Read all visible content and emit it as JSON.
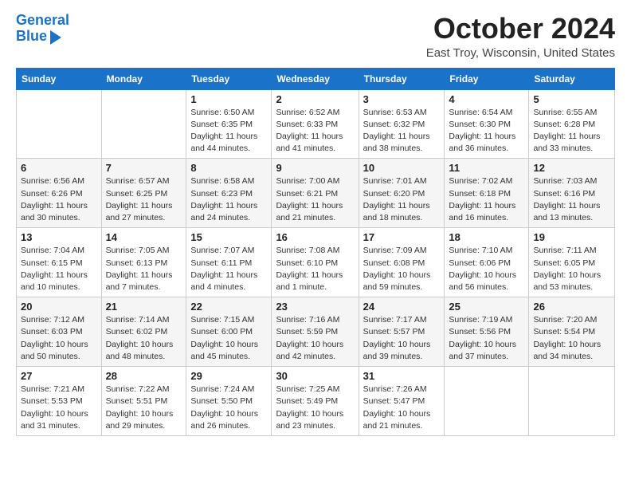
{
  "header": {
    "logo_line1": "General",
    "logo_line2": "Blue",
    "month_title": "October 2024",
    "location": "East Troy, Wisconsin, United States"
  },
  "weekdays": [
    "Sunday",
    "Monday",
    "Tuesday",
    "Wednesday",
    "Thursday",
    "Friday",
    "Saturday"
  ],
  "weeks": [
    [
      {
        "day": "",
        "sunrise": "",
        "sunset": "",
        "daylight": ""
      },
      {
        "day": "",
        "sunrise": "",
        "sunset": "",
        "daylight": ""
      },
      {
        "day": "1",
        "sunrise": "Sunrise: 6:50 AM",
        "sunset": "Sunset: 6:35 PM",
        "daylight": "Daylight: 11 hours and 44 minutes."
      },
      {
        "day": "2",
        "sunrise": "Sunrise: 6:52 AM",
        "sunset": "Sunset: 6:33 PM",
        "daylight": "Daylight: 11 hours and 41 minutes."
      },
      {
        "day": "3",
        "sunrise": "Sunrise: 6:53 AM",
        "sunset": "Sunset: 6:32 PM",
        "daylight": "Daylight: 11 hours and 38 minutes."
      },
      {
        "day": "4",
        "sunrise": "Sunrise: 6:54 AM",
        "sunset": "Sunset: 6:30 PM",
        "daylight": "Daylight: 11 hours and 36 minutes."
      },
      {
        "day": "5",
        "sunrise": "Sunrise: 6:55 AM",
        "sunset": "Sunset: 6:28 PM",
        "daylight": "Daylight: 11 hours and 33 minutes."
      }
    ],
    [
      {
        "day": "6",
        "sunrise": "Sunrise: 6:56 AM",
        "sunset": "Sunset: 6:26 PM",
        "daylight": "Daylight: 11 hours and 30 minutes."
      },
      {
        "day": "7",
        "sunrise": "Sunrise: 6:57 AM",
        "sunset": "Sunset: 6:25 PM",
        "daylight": "Daylight: 11 hours and 27 minutes."
      },
      {
        "day": "8",
        "sunrise": "Sunrise: 6:58 AM",
        "sunset": "Sunset: 6:23 PM",
        "daylight": "Daylight: 11 hours and 24 minutes."
      },
      {
        "day": "9",
        "sunrise": "Sunrise: 7:00 AM",
        "sunset": "Sunset: 6:21 PM",
        "daylight": "Daylight: 11 hours and 21 minutes."
      },
      {
        "day": "10",
        "sunrise": "Sunrise: 7:01 AM",
        "sunset": "Sunset: 6:20 PM",
        "daylight": "Daylight: 11 hours and 18 minutes."
      },
      {
        "day": "11",
        "sunrise": "Sunrise: 7:02 AM",
        "sunset": "Sunset: 6:18 PM",
        "daylight": "Daylight: 11 hours and 16 minutes."
      },
      {
        "day": "12",
        "sunrise": "Sunrise: 7:03 AM",
        "sunset": "Sunset: 6:16 PM",
        "daylight": "Daylight: 11 hours and 13 minutes."
      }
    ],
    [
      {
        "day": "13",
        "sunrise": "Sunrise: 7:04 AM",
        "sunset": "Sunset: 6:15 PM",
        "daylight": "Daylight: 11 hours and 10 minutes."
      },
      {
        "day": "14",
        "sunrise": "Sunrise: 7:05 AM",
        "sunset": "Sunset: 6:13 PM",
        "daylight": "Daylight: 11 hours and 7 minutes."
      },
      {
        "day": "15",
        "sunrise": "Sunrise: 7:07 AM",
        "sunset": "Sunset: 6:11 PM",
        "daylight": "Daylight: 11 hours and 4 minutes."
      },
      {
        "day": "16",
        "sunrise": "Sunrise: 7:08 AM",
        "sunset": "Sunset: 6:10 PM",
        "daylight": "Daylight: 11 hours and 1 minute."
      },
      {
        "day": "17",
        "sunrise": "Sunrise: 7:09 AM",
        "sunset": "Sunset: 6:08 PM",
        "daylight": "Daylight: 10 hours and 59 minutes."
      },
      {
        "day": "18",
        "sunrise": "Sunrise: 7:10 AM",
        "sunset": "Sunset: 6:06 PM",
        "daylight": "Daylight: 10 hours and 56 minutes."
      },
      {
        "day": "19",
        "sunrise": "Sunrise: 7:11 AM",
        "sunset": "Sunset: 6:05 PM",
        "daylight": "Daylight: 10 hours and 53 minutes."
      }
    ],
    [
      {
        "day": "20",
        "sunrise": "Sunrise: 7:12 AM",
        "sunset": "Sunset: 6:03 PM",
        "daylight": "Daylight: 10 hours and 50 minutes."
      },
      {
        "day": "21",
        "sunrise": "Sunrise: 7:14 AM",
        "sunset": "Sunset: 6:02 PM",
        "daylight": "Daylight: 10 hours and 48 minutes."
      },
      {
        "day": "22",
        "sunrise": "Sunrise: 7:15 AM",
        "sunset": "Sunset: 6:00 PM",
        "daylight": "Daylight: 10 hours and 45 minutes."
      },
      {
        "day": "23",
        "sunrise": "Sunrise: 7:16 AM",
        "sunset": "Sunset: 5:59 PM",
        "daylight": "Daylight: 10 hours and 42 minutes."
      },
      {
        "day": "24",
        "sunrise": "Sunrise: 7:17 AM",
        "sunset": "Sunset: 5:57 PM",
        "daylight": "Daylight: 10 hours and 39 minutes."
      },
      {
        "day": "25",
        "sunrise": "Sunrise: 7:19 AM",
        "sunset": "Sunset: 5:56 PM",
        "daylight": "Daylight: 10 hours and 37 minutes."
      },
      {
        "day": "26",
        "sunrise": "Sunrise: 7:20 AM",
        "sunset": "Sunset: 5:54 PM",
        "daylight": "Daylight: 10 hours and 34 minutes."
      }
    ],
    [
      {
        "day": "27",
        "sunrise": "Sunrise: 7:21 AM",
        "sunset": "Sunset: 5:53 PM",
        "daylight": "Daylight: 10 hours and 31 minutes."
      },
      {
        "day": "28",
        "sunrise": "Sunrise: 7:22 AM",
        "sunset": "Sunset: 5:51 PM",
        "daylight": "Daylight: 10 hours and 29 minutes."
      },
      {
        "day": "29",
        "sunrise": "Sunrise: 7:24 AM",
        "sunset": "Sunset: 5:50 PM",
        "daylight": "Daylight: 10 hours and 26 minutes."
      },
      {
        "day": "30",
        "sunrise": "Sunrise: 7:25 AM",
        "sunset": "Sunset: 5:49 PM",
        "daylight": "Daylight: 10 hours and 23 minutes."
      },
      {
        "day": "31",
        "sunrise": "Sunrise: 7:26 AM",
        "sunset": "Sunset: 5:47 PM",
        "daylight": "Daylight: 10 hours and 21 minutes."
      },
      {
        "day": "",
        "sunrise": "",
        "sunset": "",
        "daylight": ""
      },
      {
        "day": "",
        "sunrise": "",
        "sunset": "",
        "daylight": ""
      }
    ]
  ]
}
